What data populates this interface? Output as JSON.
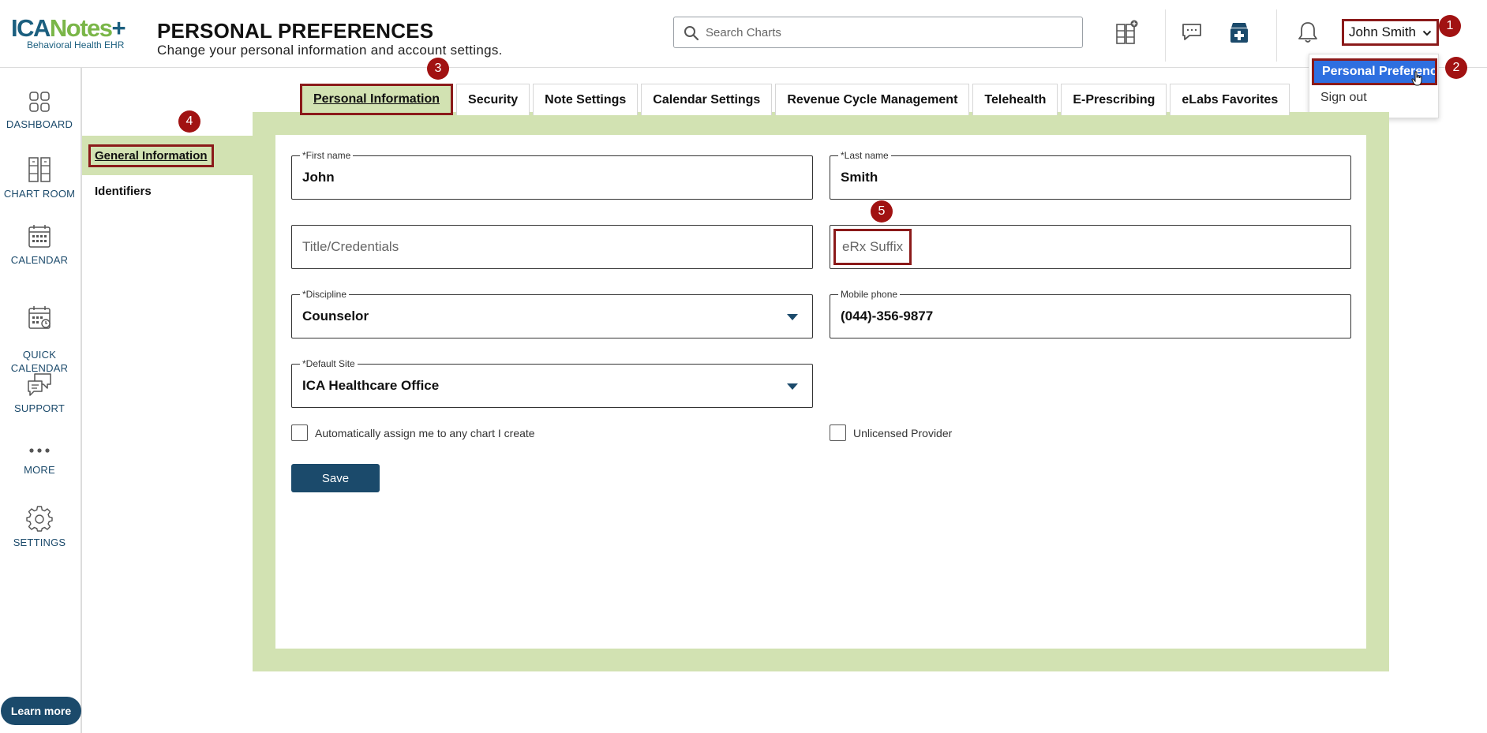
{
  "header": {
    "logo_main_1": "ICA",
    "logo_main_2": "Notes",
    "logo_main_3": "+",
    "logo_sub": "Behavioral Health EHR",
    "title": "PERSONAL PREFERENCES",
    "subtitle": "Change your personal information and account settings.",
    "search_placeholder": "Search Charts",
    "user_name": "John Smith"
  },
  "dropdown": {
    "items": [
      "Personal Preferences",
      "Sign out"
    ]
  },
  "badges": [
    "1",
    "2",
    "3",
    "4",
    "5"
  ],
  "leftnav": {
    "items": [
      {
        "label": "DASHBOARD",
        "icon": "dashboard-icon"
      },
      {
        "label": "CHART ROOM",
        "icon": "chart-room-icon"
      },
      {
        "label": "CALENDAR",
        "icon": "calendar-icon"
      },
      {
        "label": "QUICK\nCALENDAR",
        "icon": "quick-calendar-icon"
      },
      {
        "label": "SUPPORT",
        "icon": "support-icon"
      },
      {
        "label": "MORE",
        "icon": "more-icon"
      },
      {
        "label": "SETTINGS",
        "icon": "gear-icon"
      }
    ],
    "learn_more": "Learn more"
  },
  "subnav": {
    "items": [
      "General Information",
      "Identifiers"
    ]
  },
  "tabs": [
    "Personal Information",
    "Security",
    "Note Settings",
    "Calendar Settings",
    "Revenue Cycle Management",
    "Telehealth",
    "E-Prescribing",
    "eLabs Favorites"
  ],
  "form": {
    "first_name_label": "*First name",
    "first_name_value": "John",
    "last_name_label": "*Last name",
    "last_name_value": "Smith",
    "title_placeholder": "Title/Credentials",
    "erx_placeholder": "eRx Suffix",
    "discipline_label": "*Discipline",
    "discipline_value": "Counselor",
    "mobile_label": "Mobile phone",
    "mobile_value": "(044)-356-9877",
    "site_label": "*Default Site",
    "site_value": "ICA Healthcare Office",
    "auto_assign_label": "Automatically assign me to any chart I create",
    "unlicensed_label": "Unlicensed Provider",
    "save_label": "Save"
  },
  "colors": {
    "brand_blue": "#1b4a6b",
    "brand_green": "#7ab648",
    "panel_green": "#d2e2b2",
    "highlight_red": "#8b1a1a",
    "badge_red": "#a11212",
    "dropdown_active": "#2e6fe0"
  }
}
